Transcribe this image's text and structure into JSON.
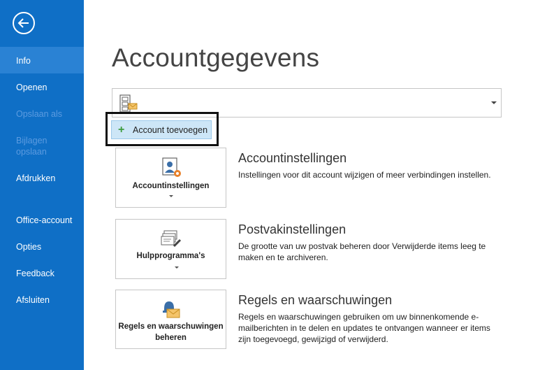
{
  "sidebar": {
    "items": [
      {
        "label": "Info"
      },
      {
        "label": "Openen"
      },
      {
        "label": "Opslaan als"
      },
      {
        "label": "Bijlagen opslaan"
      },
      {
        "label": "Afdrukken"
      },
      {
        "label": "Office-account"
      },
      {
        "label": "Opties"
      },
      {
        "label": "Feedback"
      },
      {
        "label": "Afsluiten"
      }
    ]
  },
  "main": {
    "title": "Accountgegevens",
    "add_account_label": "Account toevoegen",
    "sections": [
      {
        "button_label": "Accountinstellingen",
        "title": "Accountinstellingen",
        "description": "Instellingen voor dit account wijzigen of meer verbindingen instellen."
      },
      {
        "button_label": "Hulpprogramma's",
        "title": "Postvakinstellingen",
        "description": "De grootte van uw postvak beheren door Verwijderde items leeg te maken en te archiveren."
      },
      {
        "button_label": "Regels en waarschuwingen beheren",
        "title": "Regels en waarschuwingen",
        "description": "Regels en waarschuwingen gebruiken om uw binnenkomende e-mailberichten in te delen en updates te ontvangen wanneer er items zijn toegevoegd, gewijzigd of verwijderd."
      }
    ]
  },
  "colors": {
    "sidebar": "#0f6fc6",
    "active_item": "#2a82d4",
    "add_button": "#cde6f7"
  }
}
